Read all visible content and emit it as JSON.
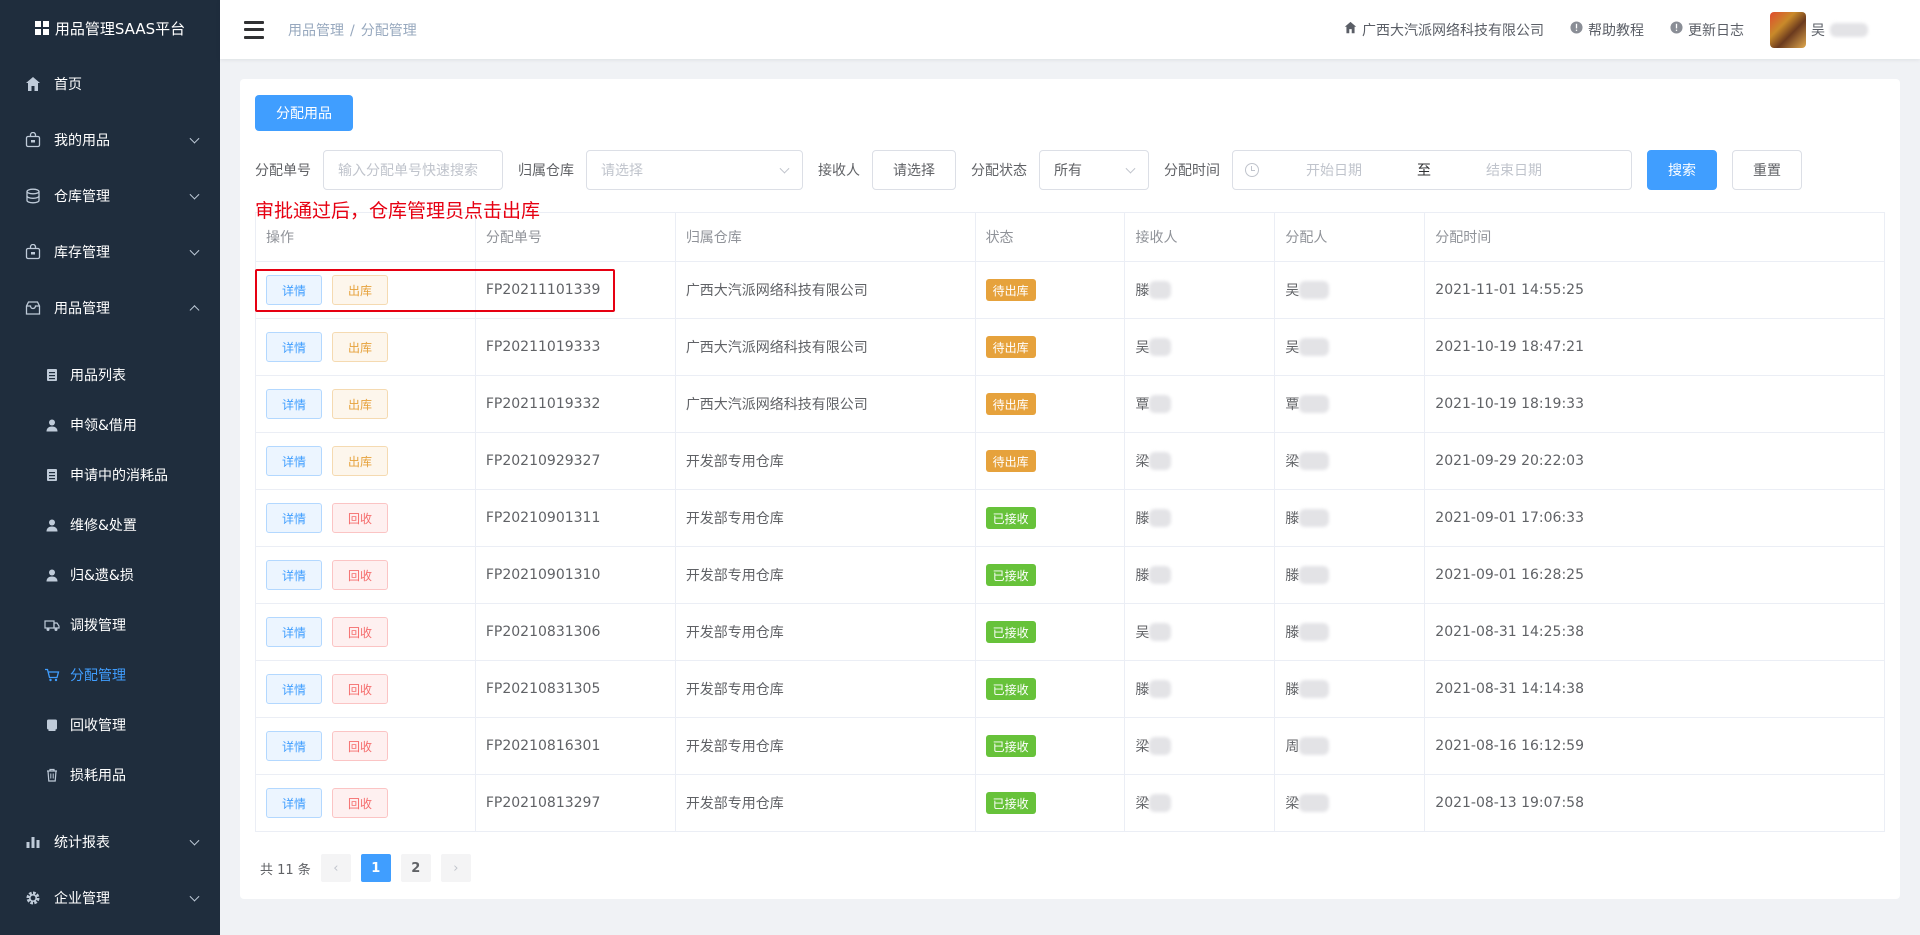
{
  "app": {
    "title": "用品管理SAAS平台"
  },
  "sidebar": {
    "items": [
      {
        "label": "首页",
        "icon": "home-icon"
      },
      {
        "label": "我的用品",
        "icon": "bag-icon"
      },
      {
        "label": "仓库管理",
        "icon": "database-icon"
      },
      {
        "label": "库存管理",
        "icon": "bag-icon"
      },
      {
        "label": "用品管理",
        "icon": "box-icon"
      }
    ],
    "sub_items": [
      {
        "label": "用品列表",
        "icon": "document-icon"
      },
      {
        "label": "申领&借用",
        "icon": "user-icon"
      },
      {
        "label": "申请中的消耗品",
        "icon": "document-icon"
      },
      {
        "label": "维修&处置",
        "icon": "user-icon"
      },
      {
        "label": "归&遗&损",
        "icon": "user-icon"
      },
      {
        "label": "调拨管理",
        "icon": "truck-icon"
      },
      {
        "label": "分配管理",
        "icon": "cart-icon"
      },
      {
        "label": "回收管理",
        "icon": "recycle-icon"
      },
      {
        "label": "损耗用品",
        "icon": "trash-icon"
      }
    ],
    "bottom_items": [
      {
        "label": "统计报表",
        "icon": "chart-icon"
      },
      {
        "label": "企业管理",
        "icon": "gear-icon"
      }
    ]
  },
  "header": {
    "breadcrumb_parent": "用品管理",
    "breadcrumb_sep": "/",
    "breadcrumb_current": "分配管理",
    "company": "广西大汽派网络科技有限公司",
    "help": "帮助教程",
    "changelog": "更新日志",
    "user_initial": "吴"
  },
  "toolbar": {
    "assign_button": "分配用品"
  },
  "filters": {
    "order_label": "分配单号",
    "order_placeholder": "输入分配单号快速搜索",
    "warehouse_label": "归属仓库",
    "warehouse_placeholder": "请选择",
    "receiver_label": "接收人",
    "receiver_button": "请选择",
    "status_label": "分配状态",
    "status_value": "所有",
    "time_label": "分配时间",
    "start_placeholder": "开始日期",
    "range_sep": "至",
    "end_placeholder": "结束日期",
    "search_button": "搜索",
    "reset_button": "重置"
  },
  "annotation": "审批通过后，仓库管理员点击出库",
  "table": {
    "columns": [
      "操作",
      "分配单号",
      "归属仓库",
      "状态",
      "接收人",
      "分配人",
      "分配时间"
    ],
    "detail_label": "详情",
    "rows": [
      {
        "action": "出库",
        "order": "FP20211101339",
        "warehouse": "广西大汽派网络科技有限公司",
        "status": "待出库",
        "receiver": "滕",
        "assigner": "吴",
        "time": "2021-11-01 14:55:25"
      },
      {
        "action": "出库",
        "order": "FP20211019333",
        "warehouse": "广西大汽派网络科技有限公司",
        "status": "待出库",
        "receiver": "吴",
        "assigner": "吴",
        "time": "2021-10-19 18:47:21"
      },
      {
        "action": "出库",
        "order": "FP20211019332",
        "warehouse": "广西大汽派网络科技有限公司",
        "status": "待出库",
        "receiver": "覃",
        "assigner": "覃",
        "time": "2021-10-19 18:19:33"
      },
      {
        "action": "出库",
        "order": "FP20210929327",
        "warehouse": "开发部专用仓库",
        "status": "待出库",
        "receiver": "梁",
        "assigner": "梁",
        "time": "2021-09-29 20:22:03"
      },
      {
        "action": "回收",
        "order": "FP20210901311",
        "warehouse": "开发部专用仓库",
        "status": "已接收",
        "receiver": "滕",
        "assigner": "滕",
        "time": "2021-09-01 17:06:33"
      },
      {
        "action": "回收",
        "order": "FP20210901310",
        "warehouse": "开发部专用仓库",
        "status": "已接收",
        "receiver": "滕",
        "assigner": "滕",
        "time": "2021-09-01 16:28:25"
      },
      {
        "action": "回收",
        "order": "FP20210831306",
        "warehouse": "开发部专用仓库",
        "status": "已接收",
        "receiver": "吴",
        "assigner": "滕",
        "time": "2021-08-31 14:25:38"
      },
      {
        "action": "回收",
        "order": "FP20210831305",
        "warehouse": "开发部专用仓库",
        "status": "已接收",
        "receiver": "滕",
        "assigner": "滕",
        "time": "2021-08-31 14:14:38"
      },
      {
        "action": "回收",
        "order": "FP20210816301",
        "warehouse": "开发部专用仓库",
        "status": "已接收",
        "receiver": "梁",
        "assigner": "周",
        "time": "2021-08-16 16:12:59"
      },
      {
        "action": "回收",
        "order": "FP20210813297",
        "warehouse": "开发部专用仓库",
        "status": "已接收",
        "receiver": "梁",
        "assigner": "梁",
        "time": "2021-08-13 19:07:58"
      }
    ]
  },
  "pagination": {
    "total": "共 11 条",
    "pages": [
      "1",
      "2"
    ],
    "current": "1",
    "prev": "‹",
    "next": "›"
  },
  "colors": {
    "primary": "#409eff",
    "warning": "#e6a23c",
    "success": "#67c23a",
    "danger": "#f56c6c",
    "sidebar_bg": "#1f2d3d",
    "annotation": "#e60012"
  }
}
